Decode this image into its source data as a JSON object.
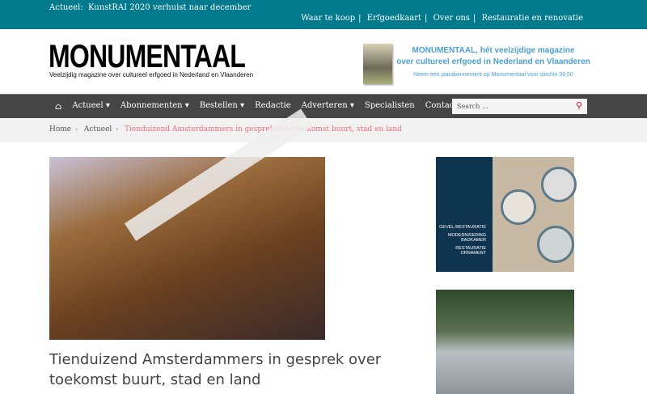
{
  "topbar": {
    "news_label": "Actueel:",
    "news_text": "KunstRAI 2020 verhuist naar december",
    "links": [
      "Waar te koop",
      "Erfgoedkaart",
      "Over ons",
      "Restauratie en renovatie"
    ]
  },
  "header": {
    "logo": "MONUMENTAAL",
    "tagline": "Veelzijdig magazine over cultureel erfgoed in Nederland en Vlaanderen",
    "promo_line1": "MONUMENTAAL, hét veelzijdige magazine",
    "promo_line2": "over cultureel erfgoed in Nederland en Vlaanderen",
    "promo_sub": "Neem een jaarabonnement op Monumentaal voor slechts 39,50"
  },
  "nav": {
    "items": [
      "Actueel ▾",
      "Abonnementen ▾",
      "Bestellen ▾",
      "Redactie",
      "Adverteren ▾",
      "Specialisten",
      "Contact"
    ],
    "search_placeholder": "Search ..."
  },
  "breadcrumb": {
    "home": "Home",
    "parent": "Actueel",
    "current": "Tienduizend Amsterdammers in gesprek over toekomst buurt, stad en land"
  },
  "article": {
    "title": "Tienduizend Amsterdammers in gesprek over toekomst buurt, stad en land"
  },
  "ad": {
    "labels": [
      "GEVEL-RESTAURATIE",
      "MODERNISERING BADKAMER",
      "RESTAURATIE ORNAMENT"
    ]
  }
}
